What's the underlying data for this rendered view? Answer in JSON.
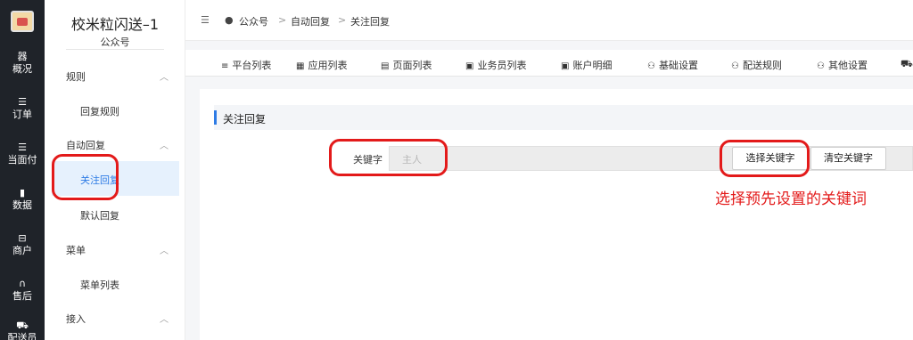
{
  "rail": {
    "items": [
      {
        "icon": "器",
        "label": "概况"
      },
      {
        "icon": "☰",
        "label": "订单"
      },
      {
        "icon": "☰",
        "label": "当面付"
      },
      {
        "icon": "▮",
        "label": "数据"
      },
      {
        "icon": "⊟",
        "label": "商户"
      },
      {
        "icon": "∩",
        "label": "售后"
      },
      {
        "icon": "⛟",
        "label": "配送员"
      }
    ]
  },
  "sidebar": {
    "title": "校米粒闪送–1",
    "subtitle": "公众号",
    "groups": [
      {
        "label": "规则",
        "items": [
          "回复规则"
        ]
      },
      {
        "label": "自动回复",
        "items": [
          "关注回复",
          "默认回复"
        ]
      },
      {
        "label": "菜单",
        "items": [
          "菜单列表"
        ]
      },
      {
        "label": "接入",
        "items": []
      }
    ],
    "active_item": "关注回复"
  },
  "breadcrumb": {
    "items": [
      "公众号",
      "自动回复",
      "关注回复"
    ],
    "separator": ">"
  },
  "tabs": [
    {
      "icon": "≡",
      "label": "平台列表"
    },
    {
      "icon": "▦",
      "label": "应用列表"
    },
    {
      "icon": "▤",
      "label": "页面列表"
    },
    {
      "icon": "▣",
      "label": "业务员列表"
    },
    {
      "icon": "▣",
      "label": "账户明细"
    },
    {
      "icon": "⚇",
      "label": "基础设置"
    },
    {
      "icon": "⚇",
      "label": "配送规则"
    },
    {
      "icon": "⚇",
      "label": "其他设置"
    }
  ],
  "section": {
    "title": "关注回复",
    "keyword_label": "关键字",
    "keyword_placeholder": "主人",
    "select_button": "选择关键字",
    "clear_button": "清空关键字"
  },
  "annotation": "选择预先设置的关键词",
  "colors": {
    "accent": "#2d7be5",
    "highlight": "#e31a1a",
    "rail": "#1f2329"
  }
}
